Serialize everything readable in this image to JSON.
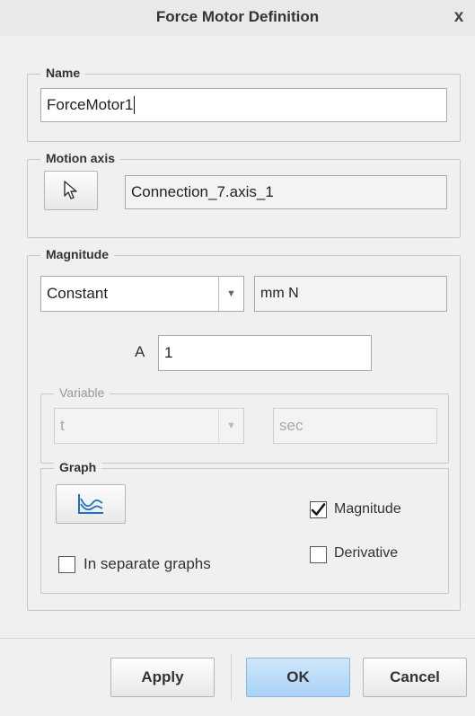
{
  "window": {
    "title": "Force Motor Definition",
    "close_glyph": "x"
  },
  "name_group": {
    "legend": "Name",
    "value": "ForceMotor1"
  },
  "motion_axis_group": {
    "legend": "Motion axis",
    "select_icon": "cursor-arrow-icon",
    "value": "Connection_7.axis_1"
  },
  "magnitude_group": {
    "legend": "Magnitude",
    "type_selected": "Constant",
    "units": "mm N",
    "a_label": "A",
    "a_value": "1",
    "variable": {
      "legend": "Variable",
      "selected": "t",
      "units": "sec"
    },
    "graph": {
      "legend": "Graph",
      "graph_icon": "graph-icon",
      "magnitude_label": "Magnitude",
      "magnitude_checked": true,
      "derivative_label": "Derivative",
      "derivative_checked": false,
      "separate_label": "In separate graphs",
      "separate_checked": false
    }
  },
  "footer": {
    "apply_label": "Apply",
    "ok_label": "OK",
    "cancel_label": "Cancel"
  }
}
